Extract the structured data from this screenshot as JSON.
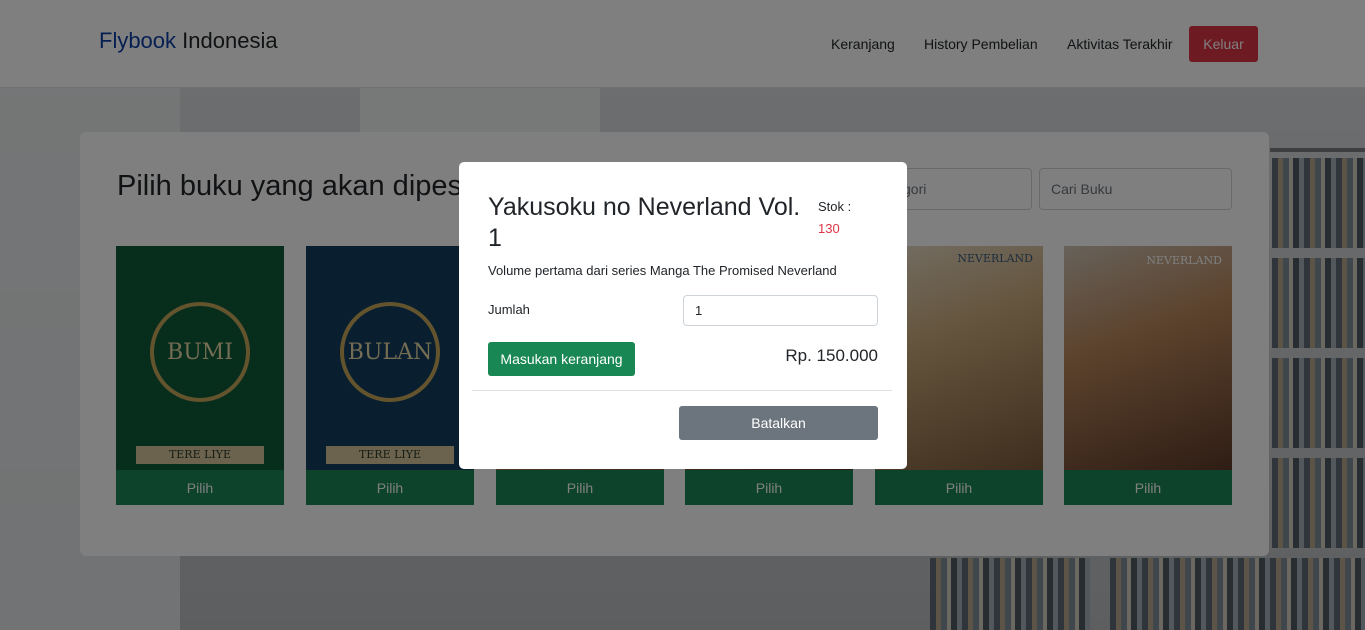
{
  "navbar": {
    "brand_part1": "Flybook",
    "brand_part2": "Indonesia",
    "links": [
      "Keranjang",
      "History Pembelian",
      "Aktivitas Terakhir"
    ],
    "logout_label": "Keluar"
  },
  "main": {
    "title": "Pilih buku yang akan dipes",
    "category_placeholder": "gori",
    "search_placeholder": "Cari Buku",
    "pick_label": "Pilih",
    "books": [
      {
        "cover_title": "BUMI",
        "cover_author": "TERE LIYE"
      },
      {
        "cover_title": "BULAN",
        "cover_author": "TERE LIYE"
      },
      {
        "cover_title": ""
      },
      {
        "cover_title": ""
      },
      {
        "cover_title": "NEVERLAND"
      },
      {
        "cover_title": "NEVERLAND"
      }
    ]
  },
  "modal": {
    "title": "Yakusoku no Neverland Vol. 1",
    "stock_label": "Stok :",
    "stock_value": "130",
    "description": "Volume pertama dari series Manga The Promised Neverland",
    "qty_label": "Jumlah",
    "qty_value": "1",
    "add_button": "Masukan keranjang",
    "price": "Rp. 150.000",
    "cancel_button": "Batalkan"
  },
  "colors": {
    "brand_blue": "#0d3fa6",
    "danger": "#dc3545",
    "success": "#198754",
    "secondary": "#6c757d"
  }
}
